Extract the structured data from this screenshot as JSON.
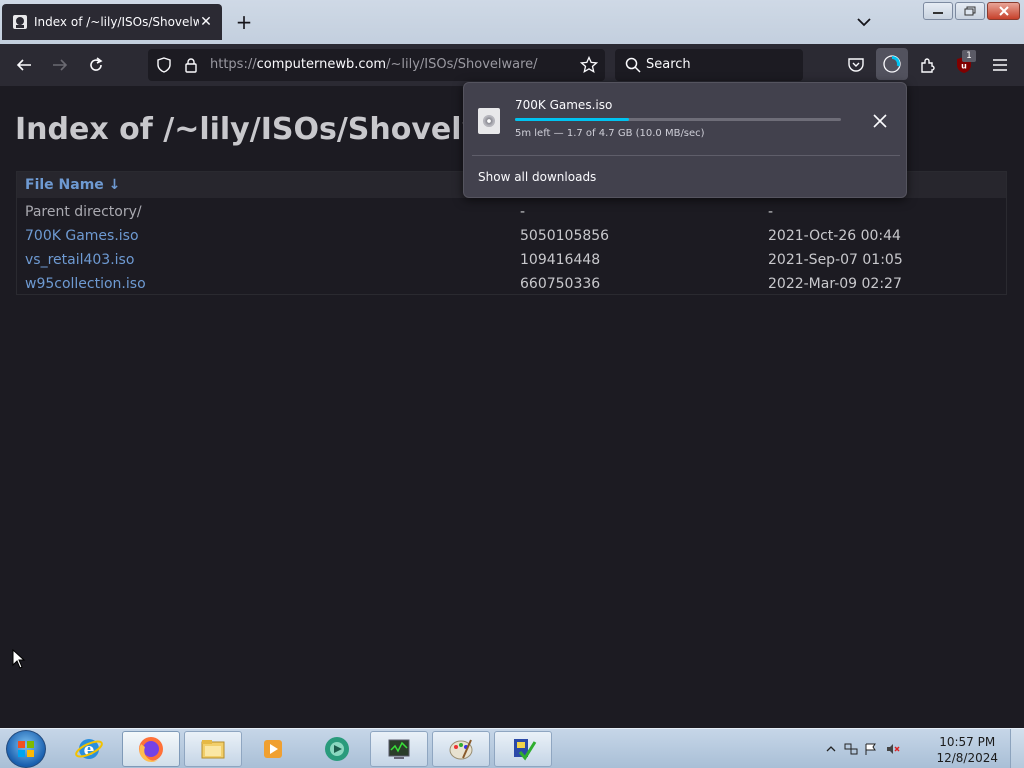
{
  "browser": {
    "tab": {
      "title": "Index of /~lily/ISOs/Shovelware",
      "close_glyph": "✕"
    },
    "new_tab_glyph": "+",
    "url": {
      "scheme": "https://",
      "host": "computernewb.com",
      "path": "/~lily/ISOs/Shovelware/"
    },
    "search_placeholder": "Search",
    "ublock_badge": "1"
  },
  "page": {
    "title": "Index of /~lily/ISOs/Shovelware/",
    "column_name": "File Name  ↓",
    "rows": [
      {
        "name": "Parent directory/",
        "size": "-",
        "date": "-",
        "kind": "plain"
      },
      {
        "name": "700K Games.iso",
        "size": "5050105856",
        "date": "2021-Oct-26 00:44",
        "kind": "link"
      },
      {
        "name": "vs_retail403.iso",
        "size": "109416448",
        "date": "2021-Sep-07 01:05",
        "kind": "link"
      },
      {
        "name": "w95collection.iso",
        "size": "660750336",
        "date": "2022-Mar-09 02:27",
        "kind": "link"
      }
    ]
  },
  "downloads_panel": {
    "file_name": "700K Games.iso",
    "progress_fraction": 0.35,
    "status": "5m left — 1.7 of 4.7 GB (10.0 MB/sec)",
    "show_all": "Show all downloads"
  },
  "taskbar": {
    "clock_time": "10:57 PM",
    "clock_date": "12/8/2024",
    "items": [
      "internet-explorer-icon",
      "firefox-icon",
      "file-explorer-icon",
      "media-player-icon",
      "disc-app-icon",
      "task-manager-icon",
      "paint-icon",
      "checklist-app-icon"
    ]
  },
  "colors": {
    "accent_progress": "#00c3f0",
    "link": "#6e9ad2",
    "page_bg": "#1c1b22",
    "toolbar_bg": "#2b2a33"
  }
}
